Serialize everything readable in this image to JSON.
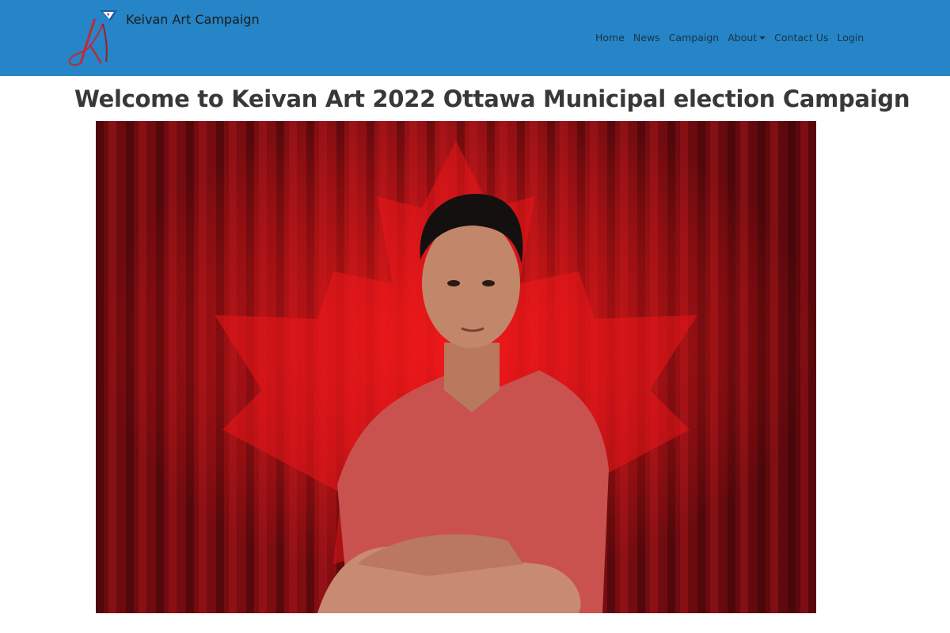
{
  "navbar": {
    "brand_text": "Keivan Art Campaign",
    "logo_icon": "ka-monogram-logo",
    "background_color": "#2585c6",
    "links": [
      {
        "label": "Home"
      },
      {
        "label": "News"
      },
      {
        "label": "Campaign"
      },
      {
        "label": "About",
        "dropdown": true
      },
      {
        "label": "Contact Us"
      },
      {
        "label": "Login"
      }
    ]
  },
  "main": {
    "title": "Welcome to Keivan Art 2022 Ottawa Municipal election Campaign",
    "hero_image_icon": "candidate-portrait-maple-leaf-curtain"
  }
}
